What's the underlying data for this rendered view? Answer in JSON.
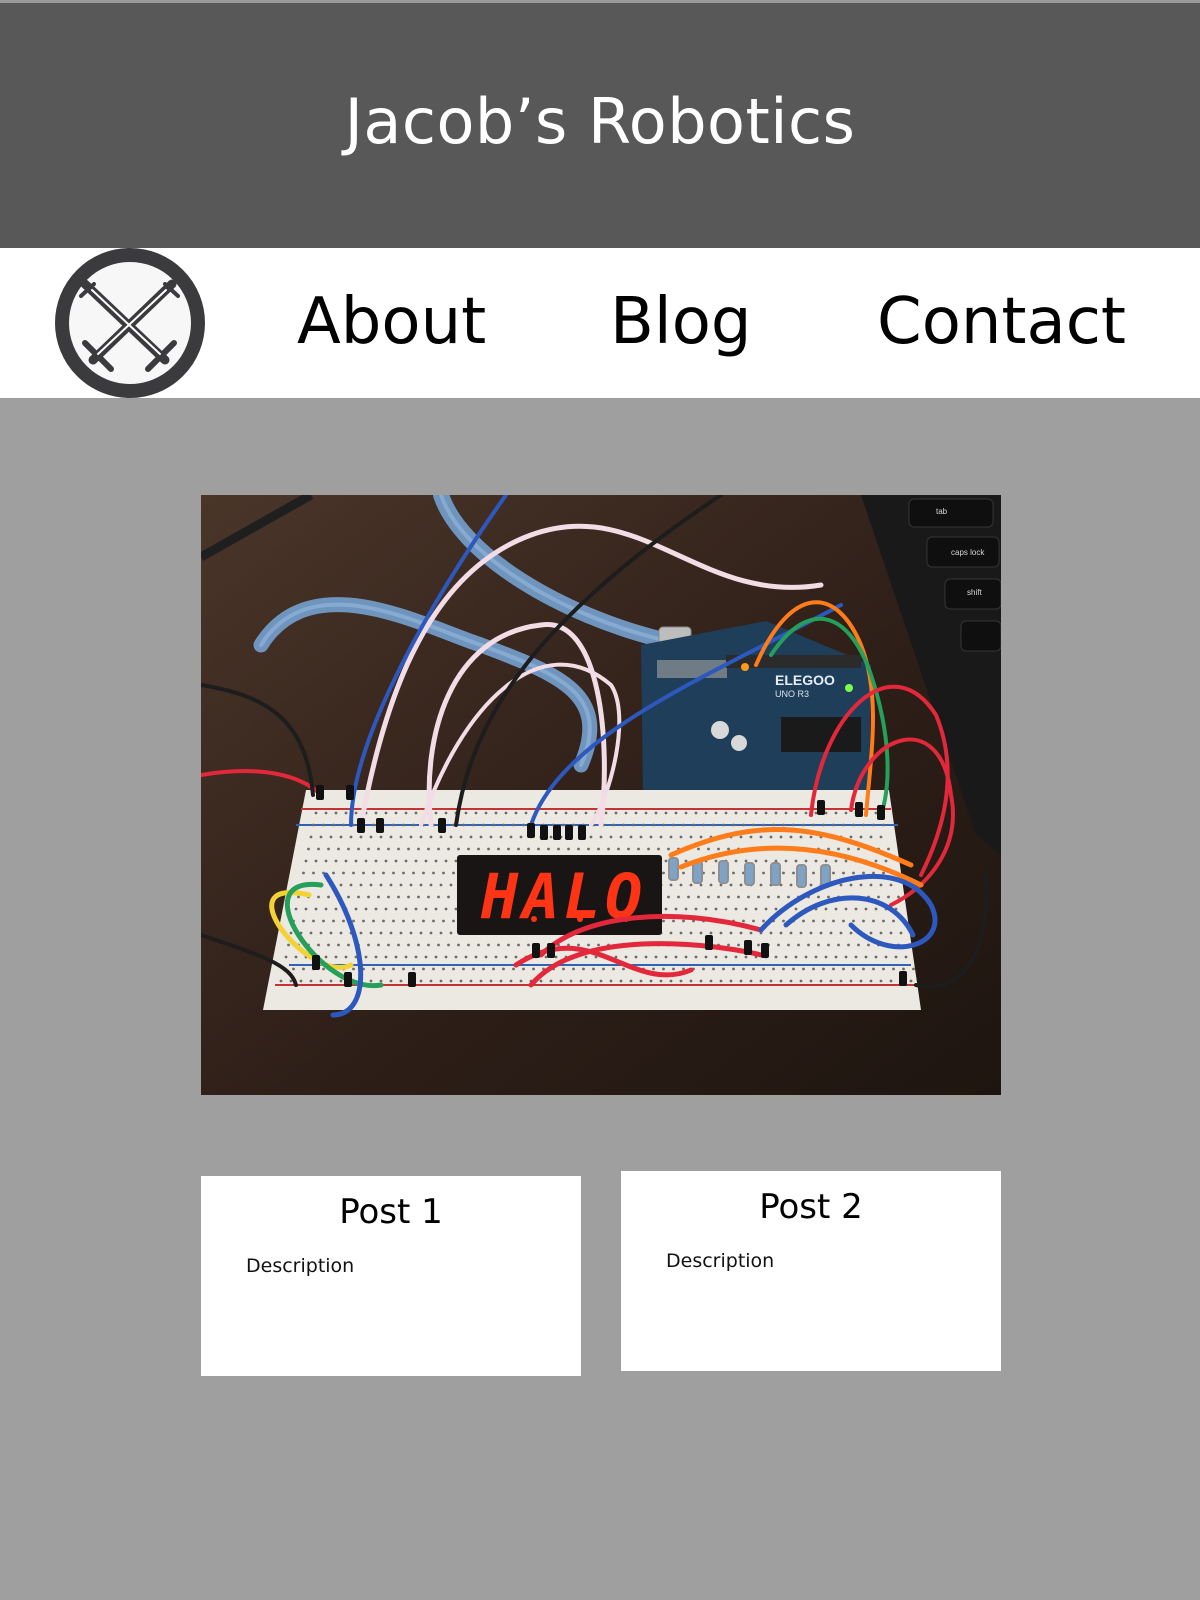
{
  "header": {
    "title": "Jacob’s Robotics"
  },
  "navbar": {
    "logo_icon": "crossed-swords-logo-icon",
    "items": [
      {
        "label": "About"
      },
      {
        "label": "Blog"
      },
      {
        "label": "Contact"
      }
    ]
  },
  "hero": {
    "image": "breadboard-with-arduino-and-seven-segment-display-photo",
    "display_text": "HALO",
    "board_label": "ELEGOO",
    "board_sublabel": "UNO R3",
    "keyboard_keys": [
      "tab",
      "caps lock",
      "shift"
    ]
  },
  "posts": [
    {
      "title": "Post 1",
      "description": "Description"
    },
    {
      "title": "Post 2",
      "description": "Description"
    }
  ],
  "colors": {
    "page_background": "#9f9f9f",
    "header_background": "#585858",
    "nav_background": "#ffffff",
    "card_background": "#ffffff",
    "title_text": "#ffffff"
  }
}
